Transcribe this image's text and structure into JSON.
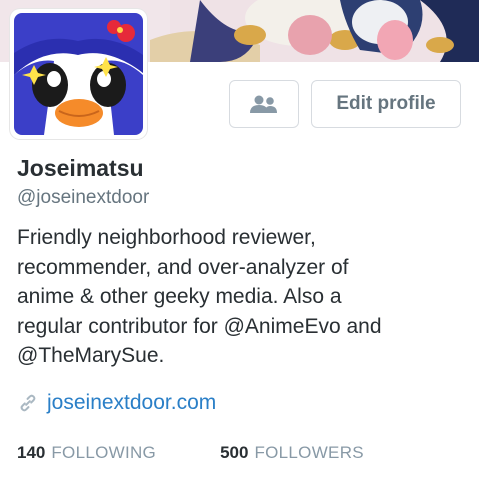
{
  "profile": {
    "display_name": "Joseimatsu",
    "handle": "@joseinextdoor",
    "bio_lines": [
      "Friendly neighborhood reviewer,",
      "recommender, and over-analyzer of",
      "anime & other geeky media. Also a",
      "regular contributor for @AnimeEvo and",
      "@TheMarySue."
    ],
    "website": "joseinextdoor.com"
  },
  "actions": {
    "edit_profile_label": "Edit profile",
    "people_icon": "people-icon"
  },
  "stats": {
    "following_count": "140",
    "following_label": "FOLLOWING",
    "followers_count": "500",
    "followers_label": "FOLLOWERS"
  },
  "colors": {
    "link": "#2a7fc7",
    "muted": "#66757f",
    "border": "#d7dbe0",
    "text": "#292f33"
  }
}
